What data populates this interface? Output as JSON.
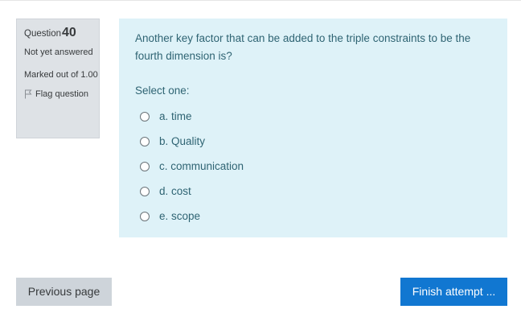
{
  "info": {
    "question_label": "Question",
    "question_number": "40",
    "state": "Not yet answered",
    "grade": "Marked out of 1.00",
    "flag_label": "Flag question"
  },
  "question": {
    "text": "Another key factor that can be added to the triple constraints to be the fourth dimension is?",
    "prompt": "Select one:",
    "options": [
      {
        "label": "a. time"
      },
      {
        "label": "b. Quality"
      },
      {
        "label": "c. communication"
      },
      {
        "label": "d. cost"
      },
      {
        "label": "e. scope"
      }
    ]
  },
  "navigation": {
    "previous_label": "Previous page",
    "finish_label": "Finish attempt ..."
  },
  "colors": {
    "info_bg": "#dee2e6",
    "content_bg": "#def2f8",
    "text_blue": "#2f6473",
    "primary": "#1177d1",
    "secondary": "#ced4da"
  }
}
